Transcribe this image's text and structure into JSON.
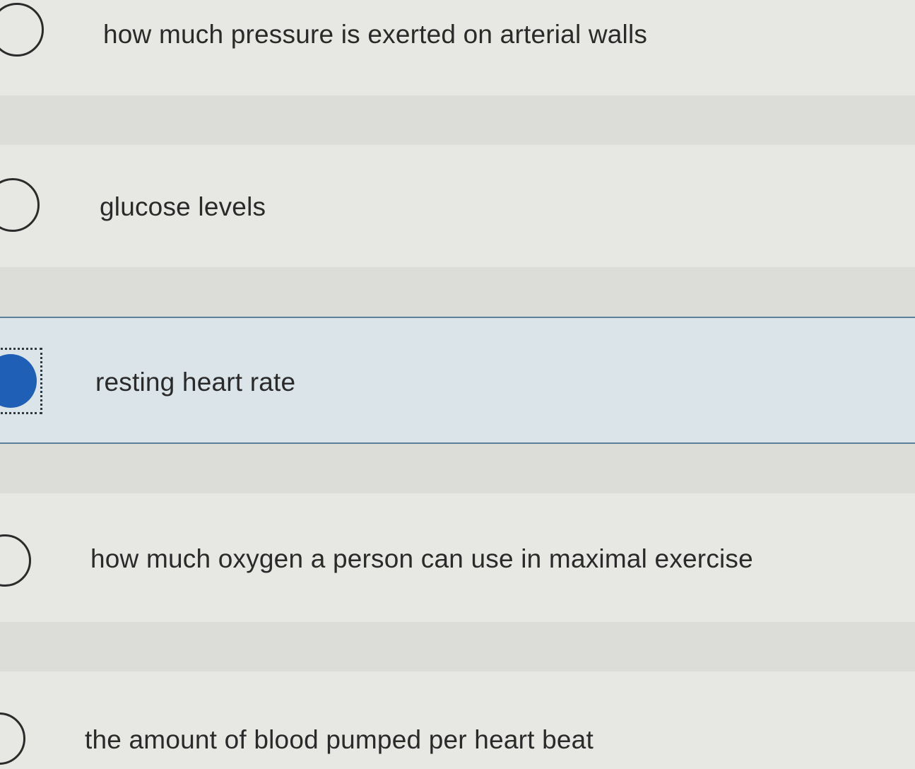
{
  "question": {
    "options": [
      {
        "label": "how much pressure is exerted on arterial walls",
        "selected": false
      },
      {
        "label": "glucose levels",
        "selected": false
      },
      {
        "label": "resting heart rate",
        "selected": true
      },
      {
        "label": "how much oxygen a person can use in maximal exercise",
        "selected": false
      },
      {
        "label": "the amount of blood pumped per heart beat",
        "selected": false
      }
    ]
  },
  "colors": {
    "selected_fill": "#1f5fb5",
    "selected_row": "#dbe4e8",
    "row_border": "#5c7f9a"
  }
}
